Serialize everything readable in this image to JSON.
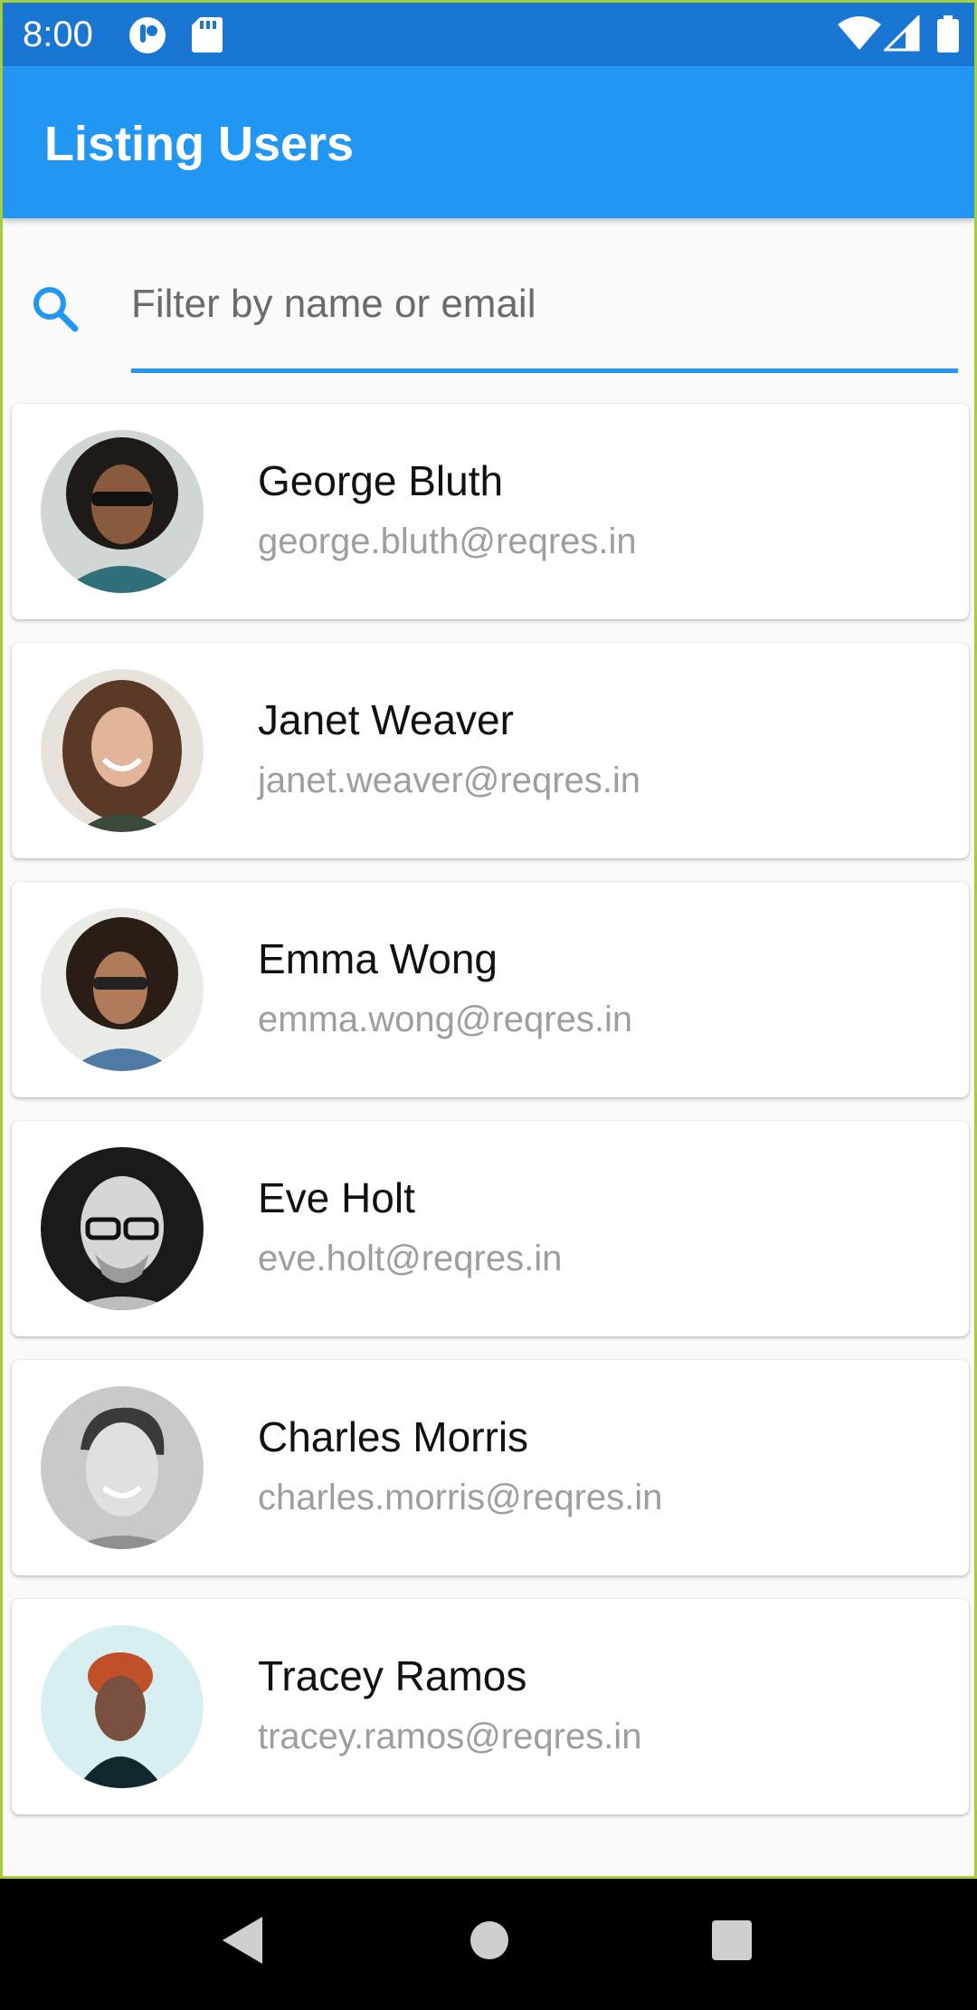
{
  "status_bar": {
    "time": "8:00",
    "icons": [
      "data-saver-icon",
      "sd-card-icon",
      "wifi-icon",
      "signal-icon",
      "battery-icon"
    ]
  },
  "app_bar": {
    "title": "Listing Users",
    "color": "#2196f3"
  },
  "search": {
    "placeholder": "Filter by name or email",
    "value": "",
    "icon": "search-icon",
    "accent": "#2196f3"
  },
  "users": [
    {
      "name": "George Bluth",
      "email": "george.bluth@reqres.in"
    },
    {
      "name": "Janet Weaver",
      "email": "janet.weaver@reqres.in"
    },
    {
      "name": "Emma Wong",
      "email": "emma.wong@reqres.in"
    },
    {
      "name": "Eve Holt",
      "email": "eve.holt@reqres.in"
    },
    {
      "name": "Charles Morris",
      "email": "charles.morris@reqres.in"
    },
    {
      "name": "Tracey Ramos",
      "email": "tracey.ramos@reqres.in"
    }
  ],
  "nav_bar": {
    "buttons": [
      "back-icon",
      "home-icon",
      "recents-icon"
    ]
  }
}
